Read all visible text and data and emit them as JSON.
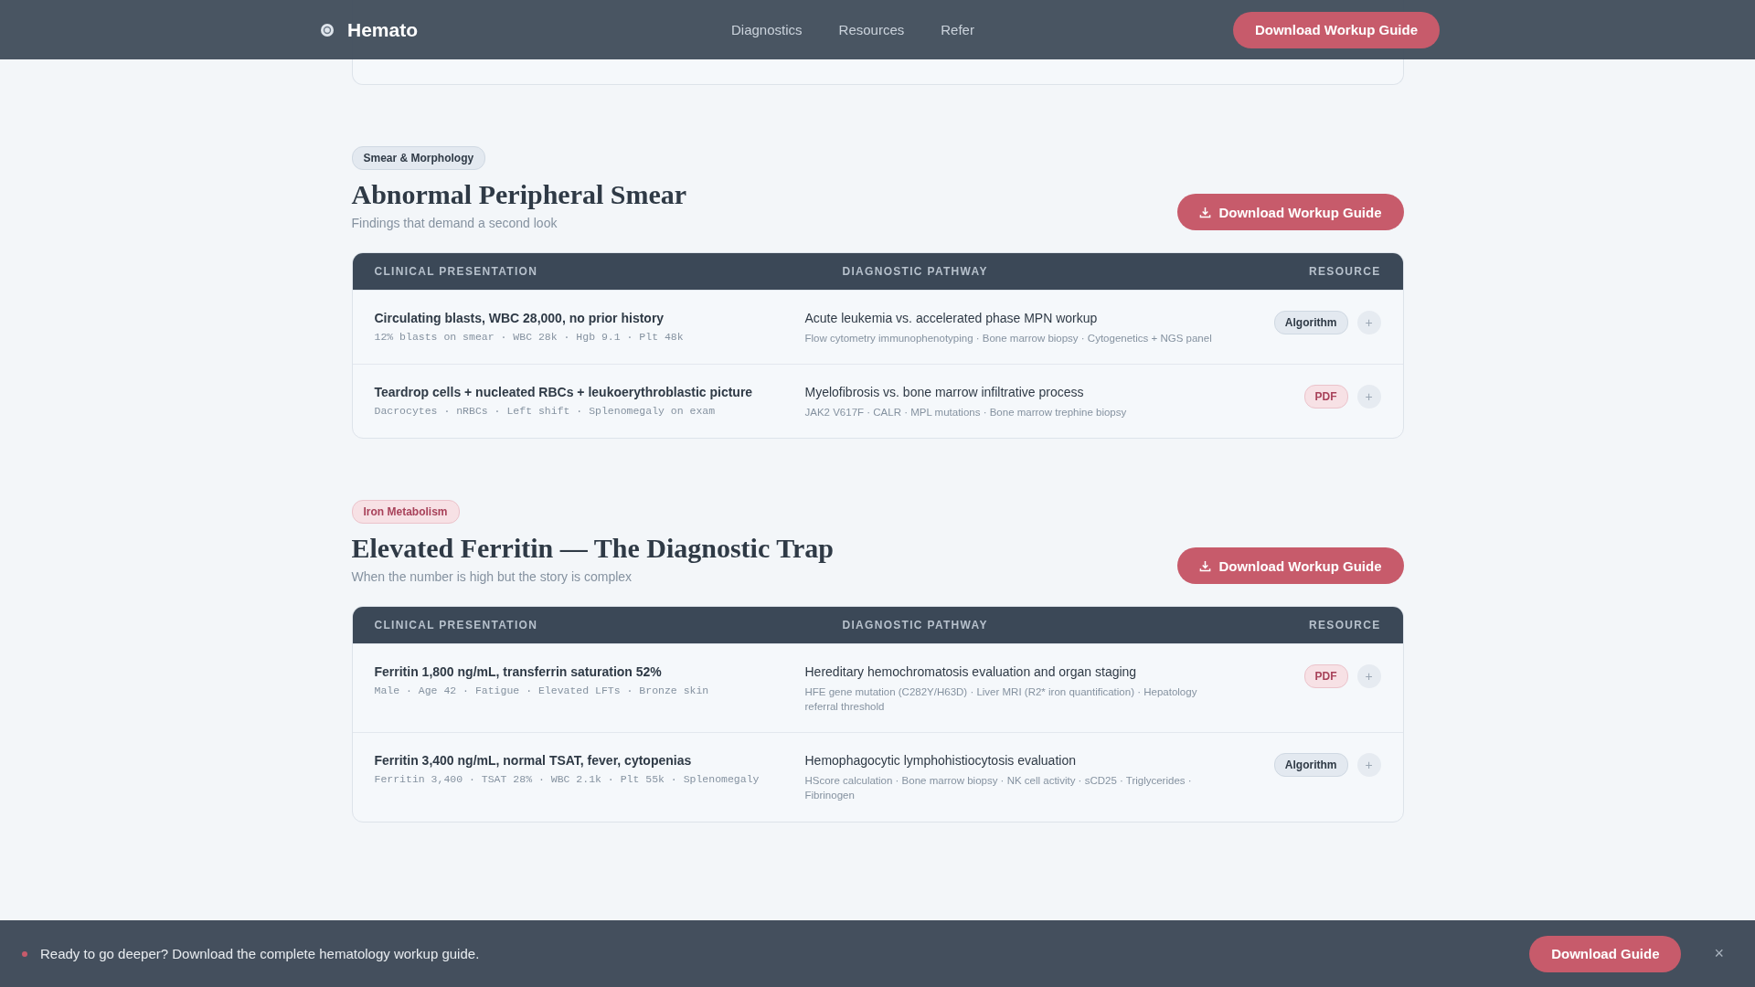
{
  "header": {
    "brand": "Hemato",
    "nav": [
      "Diagnostics",
      "Resources",
      "Refer"
    ],
    "cta": "Download Workup Guide"
  },
  "sections": [
    {
      "tag": {
        "label": "Smear & Morphology",
        "kind": "neutral"
      },
      "title": "Abnormal Peripheral Smear",
      "subtitle": "Findings that demand a second look",
      "button": "Download Workup Guide",
      "columns": [
        "CLINICAL PRESENTATION",
        "DIAGNOSTIC PATHWAY",
        "RESOURCE"
      ],
      "rows": [
        {
          "presentation": "Circulating blasts, WBC 28,000, no prior history",
          "details": "12% blasts on smear · WBC 28k · Hgb 9.1 · Plt 48k",
          "pathway": "Acute leukemia vs. accelerated phase MPN workup",
          "tests": "Flow cytometry immunophenotyping · Bone marrow biopsy · Cytogenetics + NGS panel",
          "resource": {
            "label": "Algorithm",
            "kind": "algorithm"
          },
          "add": "+"
        },
        {
          "presentation": "Teardrop cells + nucleated RBCs + leukoerythroblastic picture",
          "details": "Dacrocytes · nRBCs · Left shift · Splenomegaly on exam",
          "pathway": "Myelofibrosis vs. bone marrow infiltrative process",
          "tests": "JAK2 V617F · CALR · MPL mutations · Bone marrow trephine biopsy",
          "resource": {
            "label": "PDF",
            "kind": "pdf"
          },
          "add": "+"
        }
      ]
    },
    {
      "tag": {
        "label": "Iron Metabolism",
        "kind": "rose"
      },
      "title": "Elevated Ferritin — The Diagnostic Trap",
      "subtitle": "When the number is high but the story is complex",
      "button": "Download Workup Guide",
      "columns": [
        "CLINICAL PRESENTATION",
        "DIAGNOSTIC PATHWAY",
        "RESOURCE"
      ],
      "rows": [
        {
          "presentation": "Ferritin 1,800 ng/mL, transferrin saturation 52%",
          "details": "Male · Age 42 · Fatigue · Elevated LFTs · Bronze skin",
          "pathway": "Hereditary hemochromatosis evaluation and organ staging",
          "tests": "HFE gene mutation (C282Y/H63D) · Liver MRI (R2* iron quantification) · Hepatology referral threshold",
          "resource": {
            "label": "PDF",
            "kind": "pdf"
          },
          "add": "+"
        },
        {
          "presentation": "Ferritin 3,400 ng/mL, normal TSAT, fever, cytopenias",
          "details": "Ferritin 3,400 · TSAT 28% · WBC 2.1k · Plt 55k · Splenomegaly",
          "pathway": "Hemophagocytic lymphohistiocytosis evaluation",
          "tests": "HScore calculation · Bone marrow biopsy · NK cell activity · sCD25 · Triglycerides · Fibrinogen",
          "resource": {
            "label": "Algorithm",
            "kind": "algorithm"
          },
          "add": "+"
        }
      ]
    }
  ],
  "banner": {
    "text": "Ready to go deeper? Download the complete hematology workup guide.",
    "button": "Download Guide",
    "close": "×"
  }
}
